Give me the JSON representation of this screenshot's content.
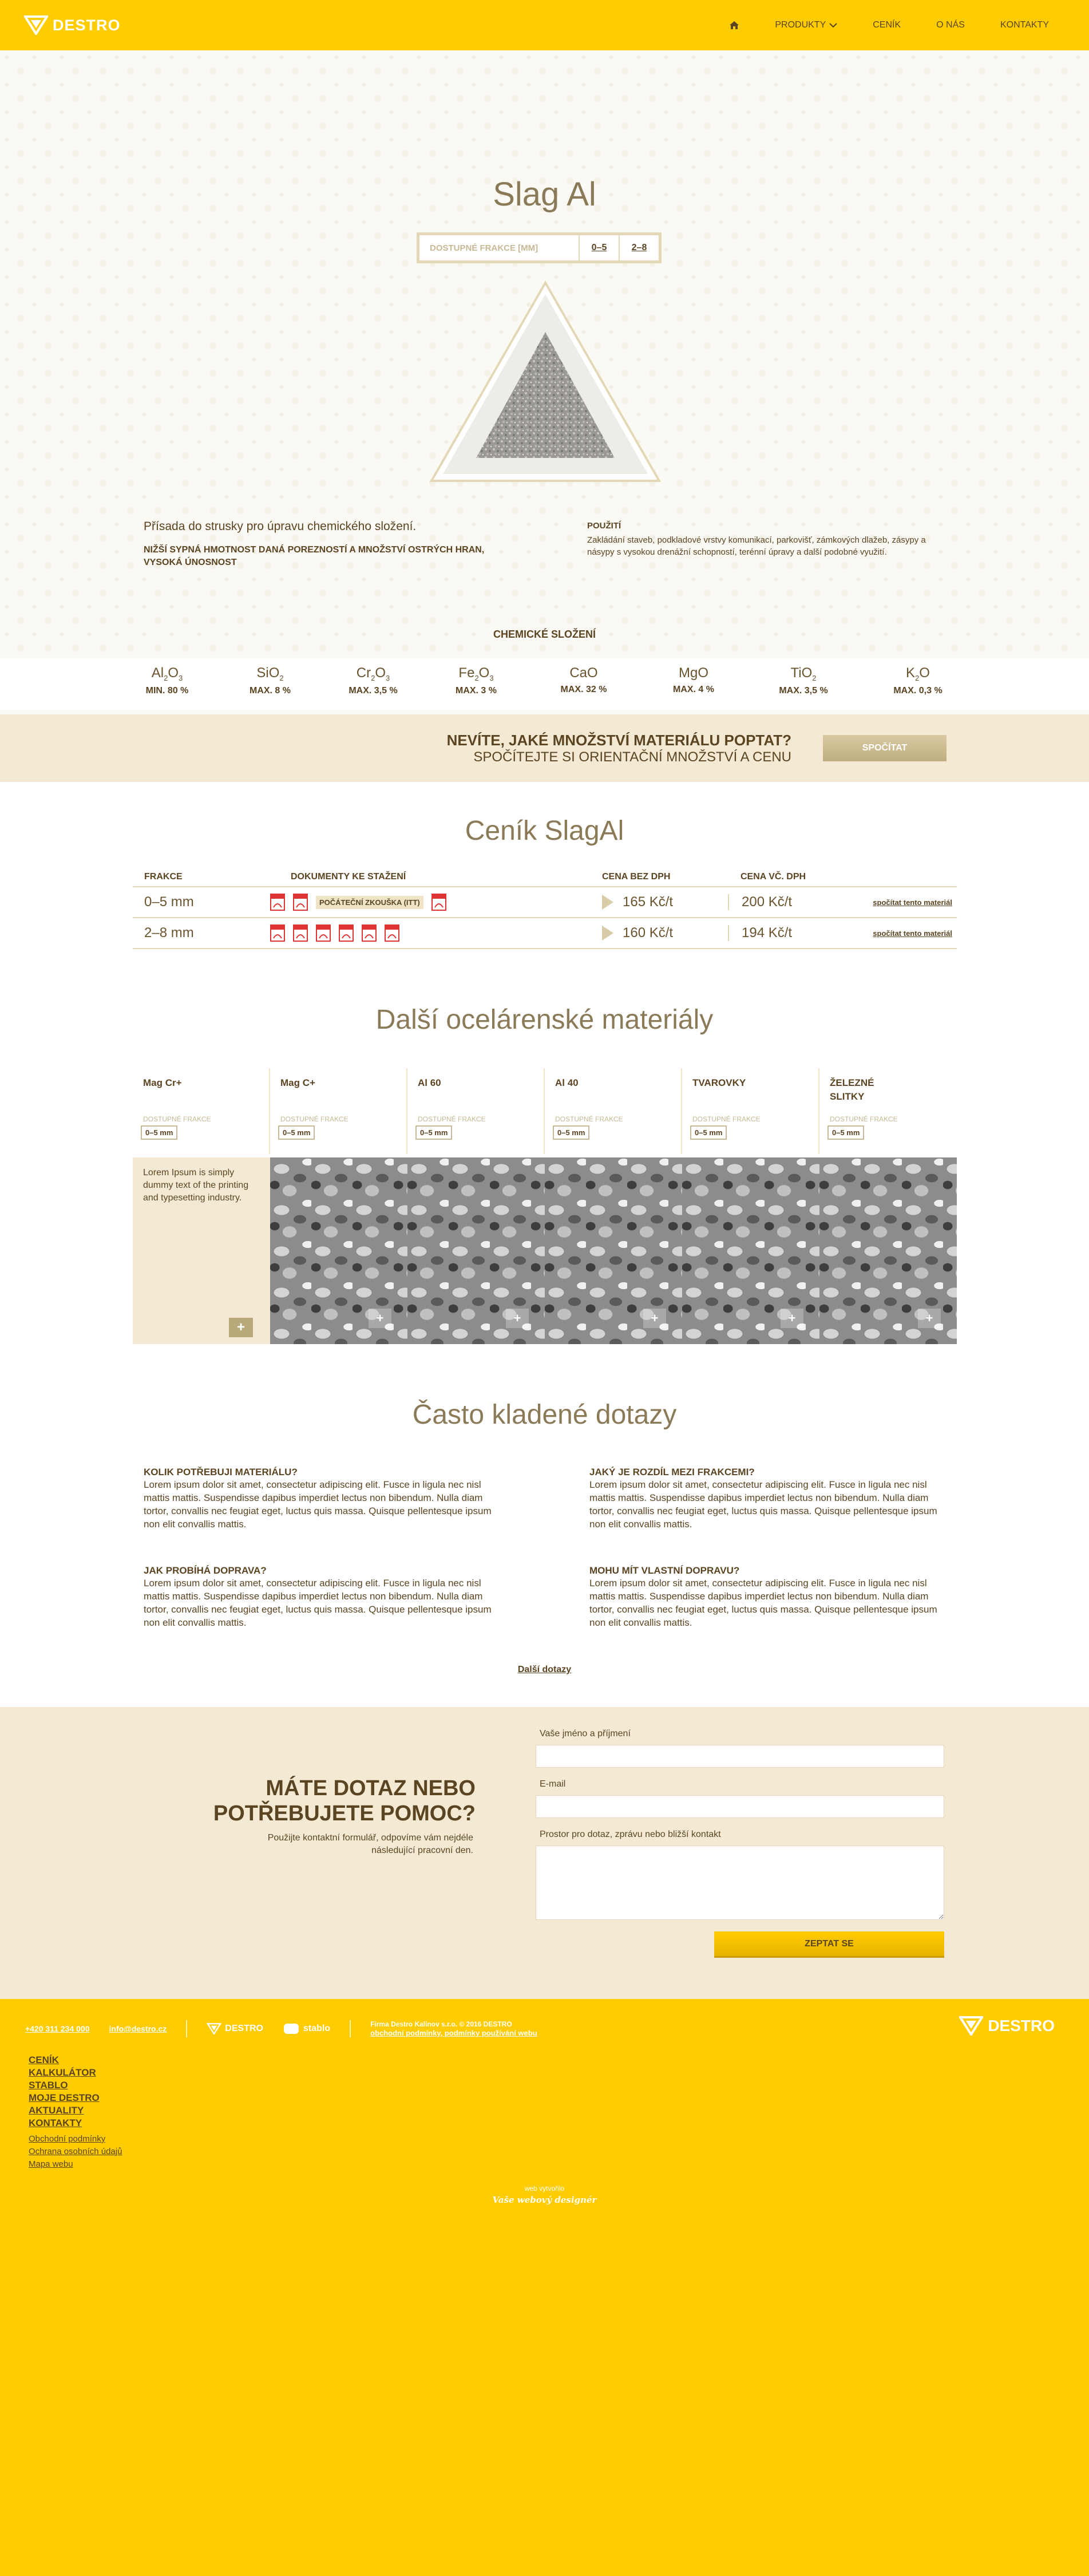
{
  "header": {
    "logo_text": "DESTRO",
    "nav": {
      "home_icon": "home-icon",
      "products": "PRODUKTY",
      "pricelist": "CENÍK",
      "about": "O NÁS",
      "contacts": "KONTAKTY"
    }
  },
  "hero": {
    "title": "Slag Al",
    "fractions_label": "DOSTUPNÉ FRAKCE [mm]",
    "fractions": [
      "0–5",
      "2–8"
    ],
    "description_lead": "Přísada do strusky pro úpravu chemického složení.",
    "description_bold": "NIŽŠÍ SYPNÁ HMOTNOST DANÁ POREZNOSTÍ A MNOŽSTVÍ OSTRÝCH HRAN, VYSOKÁ ÚNOSNOST",
    "usage_heading": "POUŽITÍ",
    "usage_text": "Zakládání staveb, podkladové vrstvy komunikací, parkovišť, zámkových dlažeb, zásypy a násypy s vysokou drenážní schopností, terénní úpravy a další podobné využití."
  },
  "chem": {
    "heading": "CHEMICKÉ SLOŽENÍ",
    "items": [
      {
        "base": "Al",
        "sub1": "2",
        "mid": "O",
        "sub2": "3",
        "value": "MIN. 80 %"
      },
      {
        "base": "SiO",
        "sub1": "2",
        "mid": "",
        "sub2": "",
        "value": "MAX. 8 %"
      },
      {
        "base": "Cr",
        "sub1": "2",
        "mid": "O",
        "sub2": "3",
        "value": "MAX. 3,5 %"
      },
      {
        "base": "Fe",
        "sub1": "2",
        "mid": "O",
        "sub2": "3",
        "value": "MAX. 3 %"
      },
      {
        "base": "CaO",
        "sub1": "",
        "mid": "",
        "sub2": "",
        "value": "MAX. 32 %"
      },
      {
        "base": "MgO",
        "sub1": "",
        "mid": "",
        "sub2": "",
        "value": "MAX. 4 %"
      },
      {
        "base": "TiO",
        "sub1": "2",
        "mid": "",
        "sub2": "",
        "value": "MAX. 3,5 %"
      },
      {
        "base": "K",
        "sub1": "2",
        "mid": "O",
        "sub2": "",
        "value": "MAX. 0,3 %"
      }
    ]
  },
  "cta": {
    "line1": "NEVÍTE, JAKÉ MNOŽSTVÍ MATERIÁLU POPTAT?",
    "line2": "SPOČÍTEJTE SI ORIENTAČNÍ MNOŽSTVÍ A CENU",
    "button": "SPOČÍTAT"
  },
  "pricelist": {
    "title": "Ceník SlagAl",
    "headers": {
      "fraction": "FRAKCE",
      "docs": "DOKUMENTY KE STAŽENÍ",
      "price_excl": "CENA BEZ DPH",
      "price_incl": "CENA VČ. DPH"
    },
    "rows": [
      {
        "fraction": "0–5 mm",
        "doc_label": "POČÁTEČNÍ ZKOUŠKA (ITT)",
        "price_excl": "165 Kč/t",
        "price_incl": "200 Kč/t",
        "link": "spočítat tento materiál"
      },
      {
        "fraction": "2–8 mm",
        "doc_label": "",
        "price_excl": "160 Kč/t",
        "price_incl": "194 Kč/t",
        "link": "spočítat tento materiál"
      }
    ]
  },
  "materials": {
    "title": "Další ocelárenské materiály",
    "fraction_label": "DOSTUPNÉ FRAKCE",
    "items": [
      {
        "name": "Mag Cr+",
        "fraction": "0–5 mm"
      },
      {
        "name": "Mag C+",
        "fraction": "0–5 mm"
      },
      {
        "name": "Al 60",
        "fraction": "0–5 mm"
      },
      {
        "name": "Al 40",
        "fraction": "0–5 mm"
      },
      {
        "name": "TVAROVKY",
        "fraction": "0–5 mm"
      },
      {
        "name": "ŽELEZNÉ SLITKY",
        "fraction": "0–5 mm"
      }
    ],
    "lorem": "Lorem Ipsum is simply dummy text of the printing and typesetting industry."
  },
  "faq": {
    "title": "Často kladené dotazy",
    "items": [
      {
        "q": "KOLIK POTŘEBUJI MATERIÁLU?",
        "a": "Lorem ipsum dolor sit amet, consectetur adipiscing elit. Fusce in ligula nec nisl mattis mattis. Suspendisse dapibus imperdiet lectus non bibendum. Nulla diam tortor, convallis nec feugiat eget, luctus quis massa. Quisque pellentesque ipsum non elit convallis mattis."
      },
      {
        "q": "JAKÝ JE ROZDÍL MEZI FRAKCEMI?",
        "a": "Lorem ipsum dolor sit amet, consectetur adipiscing elit. Fusce in ligula nec nisl mattis mattis. Suspendisse dapibus imperdiet lectus non bibendum. Nulla diam tortor, convallis nec feugiat eget, luctus quis massa. Quisque pellentesque ipsum non elit convallis mattis."
      },
      {
        "q": "JAK PROBÍHÁ DOPRAVA?",
        "a": "Lorem ipsum dolor sit amet, consectetur adipiscing elit. Fusce in ligula nec nisl mattis mattis. Suspendisse dapibus imperdiet lectus non bibendum. Nulla diam tortor, convallis nec feugiat eget, luctus quis massa. Quisque pellentesque ipsum non elit convallis mattis."
      },
      {
        "q": "MOHU MÍT VLASTNÍ DOPRAVU?",
        "a": "Lorem ipsum dolor sit amet, consectetur adipiscing elit. Fusce in ligula nec nisl mattis mattis. Suspendisse dapibus imperdiet lectus non bibendum. Nulla diam tortor, convallis nec feugiat eget, luctus quis massa. Quisque pellentesque ipsum non elit convallis mattis."
      }
    ],
    "more": "Další dotazy"
  },
  "contact": {
    "title_line1": "MÁTE DOTAZ NEBO",
    "title_line2": "POTŘEBUJETE POMOC?",
    "subtitle": "Použijte kontaktní formulář, odpovíme vám nejdéle následující pracovní den.",
    "name_label": "Vaše jméno a příjmení",
    "email_label": "E-mail",
    "message_label": "Prostor pro dotaz, zprávu nebo bližší kontakt",
    "submit": "ZEPTAT SE"
  },
  "footer": {
    "phone": "+420 311 234 000",
    "email": "info@destro.cz",
    "brand1": "DESTRO",
    "brand2": "stablo",
    "legal_line1": "Firma Destro Kalinov s.r.o. © 2016 DESTRO",
    "legal_line2": "obchodní podmínky, podmínky používání webu",
    "logo_text": "DESTRO",
    "main_links": [
      "CENÍK",
      "KALKULÁTOR",
      "STABLO",
      "MOJE DESTRO",
      "AKTUALITY",
      "KONTAKTY"
    ],
    "small_links": [
      "Obchodní podmínky",
      "Ochrana osobních údajů",
      "Mapa webu"
    ],
    "made_by_label": "web vytvořilo",
    "made_by": "Vaše webový designér"
  },
  "colors": {
    "brand_yellow": "#ffcc00",
    "text_brown": "#5b4422",
    "beige": "#f4ead3",
    "gold_border": "#e3d7b6"
  }
}
